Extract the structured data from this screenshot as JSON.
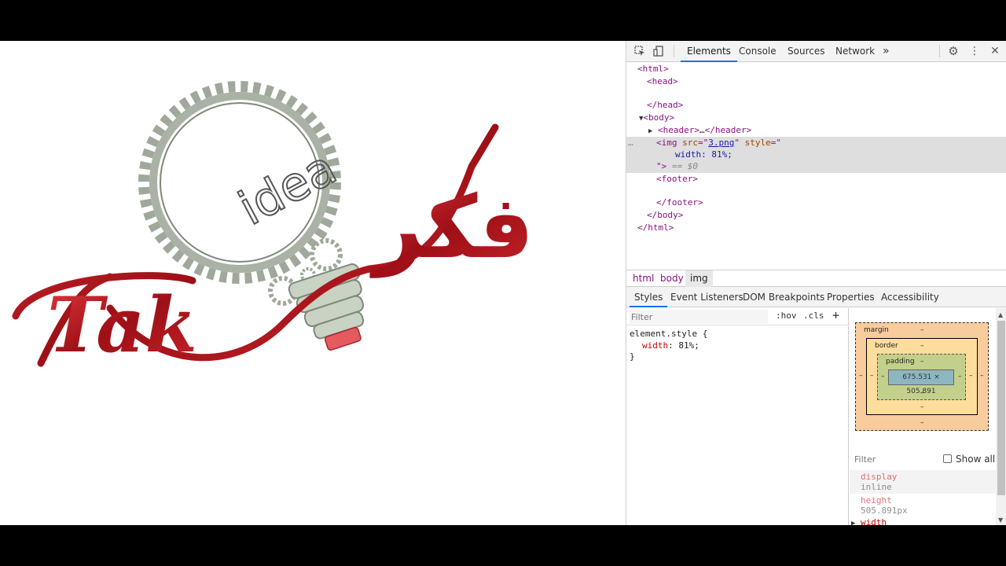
{
  "devtools": {
    "toolbar": {
      "tabs": [
        {
          "label": "Elements",
          "active": true
        },
        {
          "label": "Console"
        },
        {
          "label": "Sources"
        },
        {
          "label": "Network"
        }
      ],
      "more": "»",
      "icons": [
        "inspect-element-icon",
        "device-toolbar-icon",
        "settings-icon",
        "more-vert-icon",
        "close-icon"
      ]
    },
    "dom": {
      "html_open": "<html>",
      "head_open": "<head>",
      "head_close": "</head>",
      "body_open": "<body>",
      "header_open": "<header>",
      "header_ellipsis": "…",
      "header_close": "</header>",
      "img_open": "<img",
      "src_attr": "src",
      "src_value": "3.png",
      "style_attr": "style",
      "style_value": "width: 81%;",
      "dollar0": "== $0",
      "footer_open": "<footer>",
      "footer_close": "</footer>",
      "body_close": "</body>",
      "html_close": "</html>",
      "dots": "…"
    },
    "breadcrumbs": [
      {
        "label": "html"
      },
      {
        "label": "body"
      },
      {
        "label": "img",
        "active": true
      }
    ],
    "subtabs": [
      {
        "label": "Styles",
        "active": true
      },
      {
        "label": "Event Listeners"
      },
      {
        "label": "DOM Breakpoints"
      },
      {
        "label": "Properties"
      },
      {
        "label": "Accessibility"
      }
    ],
    "styles": {
      "filter_placeholder": "Filter",
      "hov": ":hov",
      "cls": ".cls",
      "plus": "+",
      "selector": "element.style {",
      "prop": "width",
      "value": "81%;",
      "close": "}"
    },
    "boxmodel": {
      "margin_label": "margin",
      "border_label": "border",
      "padding_label": "padding",
      "dash": "–",
      "content": "675.531 × 505.891"
    },
    "computed": {
      "filter_placeholder": "Filter",
      "show_all": "Show all",
      "props": [
        {
          "name": "display",
          "value": "inline"
        },
        {
          "name": "height",
          "value": "505.891px"
        },
        {
          "name": "width",
          "value": ""
        }
      ]
    }
  },
  "logo": {
    "word_en": "Tak",
    "word_idea": "idea",
    "word_ar": "فكر",
    "colors": {
      "red": "#b3121b",
      "gear": "#a9b2a5",
      "bulb": "#c9d3c3",
      "bulb_tip": "#e55a5f"
    }
  }
}
